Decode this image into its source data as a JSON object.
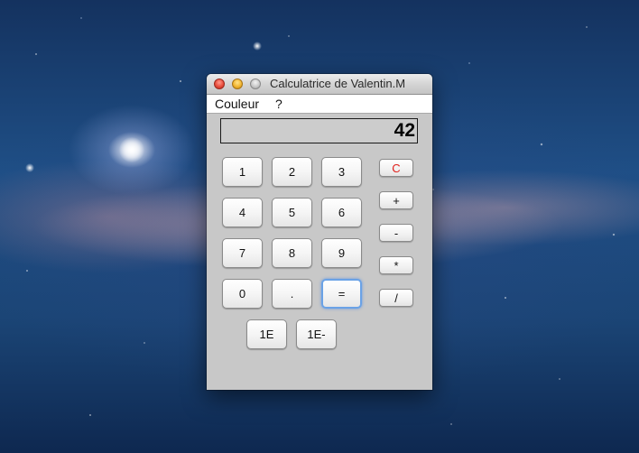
{
  "window": {
    "title": "Calculatrice de Valentin.M"
  },
  "menu": {
    "items": [
      "Couleur",
      "?"
    ]
  },
  "display": {
    "value": "42"
  },
  "keypad": {
    "digits": [
      "1",
      "2",
      "3",
      "4",
      "5",
      "6",
      "7",
      "8",
      "9",
      "0"
    ],
    "dot": ".",
    "equals": "=",
    "exp_plus": "1E",
    "exp_minus": "1E-"
  },
  "operators": {
    "clear": "C",
    "plus": "+",
    "minus": "-",
    "multiply": "*",
    "divide": "/"
  },
  "colors": {
    "clear_text": "#e0201b",
    "focus_ring": "#6aa2e6",
    "window_bg": "#c8c8c8"
  }
}
